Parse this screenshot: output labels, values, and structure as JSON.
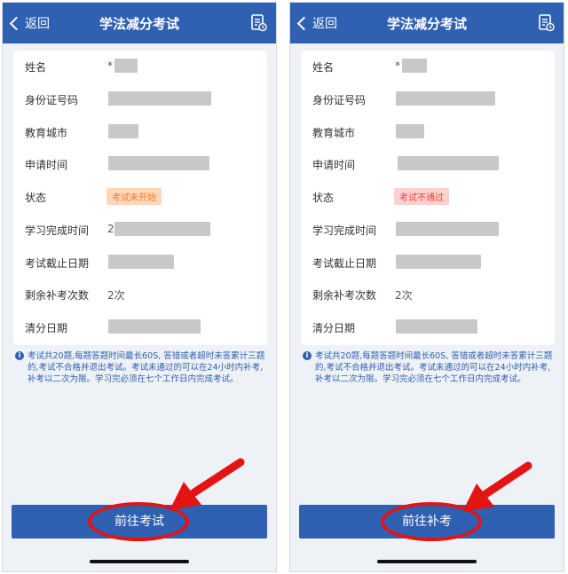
{
  "left": {
    "nav": {
      "back_label": "返回",
      "title": "学法减分考试"
    },
    "fields": {
      "name": {
        "label": "姓名",
        "value": "*"
      },
      "id_number": {
        "label": "身份证号码"
      },
      "city": {
        "label": "教育城市"
      },
      "apply_time": {
        "label": "申请时间"
      },
      "status": {
        "label": "状态",
        "value": "考试未开始"
      },
      "finish_time": {
        "label": "学习完成时间",
        "value": "2"
      },
      "deadline": {
        "label": "考试截止日期"
      },
      "remaining": {
        "label": "剩余补考次数",
        "value": "2次"
      },
      "clear_date": {
        "label": "清分日期"
      }
    },
    "notice": "考试共20题,每题答题时间最长60S, 答错或者超时未答累计三题的,考试不合格并退出考试。考试未通过的可以在24小时内补考,补考以二次为限。学习完必须在七个工作日内完成考试。",
    "button_label": "前往考试"
  },
  "right": {
    "nav": {
      "back_label": "返回",
      "title": "学法减分考试"
    },
    "fields": {
      "name": {
        "label": "姓名",
        "value": "*"
      },
      "id_number": {
        "label": "身份证号码"
      },
      "city": {
        "label": "教育城市"
      },
      "apply_time": {
        "label": "申请时间"
      },
      "status": {
        "label": "状态",
        "value": "考试不通过"
      },
      "finish_time": {
        "label": "学习完成时间"
      },
      "deadline": {
        "label": "考试截止日期"
      },
      "remaining": {
        "label": "剩余补考次数",
        "value": "2次"
      },
      "clear_date": {
        "label": "清分日期"
      }
    },
    "notice": "考试共20题,每题答题时间最长60S, 答错或者超时未答累计三题的,考试不合格并退出考试。考试未通过的可以在24小时内补考,补考以二次为限。学习完必须在七个工作日内完成考试。",
    "button_label": "前往补考"
  },
  "colors": {
    "primary": "#2f60b1",
    "annotation": "#e31414",
    "status_not_started": "#f27b2a",
    "status_failed": "#e8453c"
  },
  "icons": {
    "back": "chevron-left-icon",
    "doc": "document-clock-icon",
    "info": "info-icon",
    "annotation": "red-arrow"
  }
}
